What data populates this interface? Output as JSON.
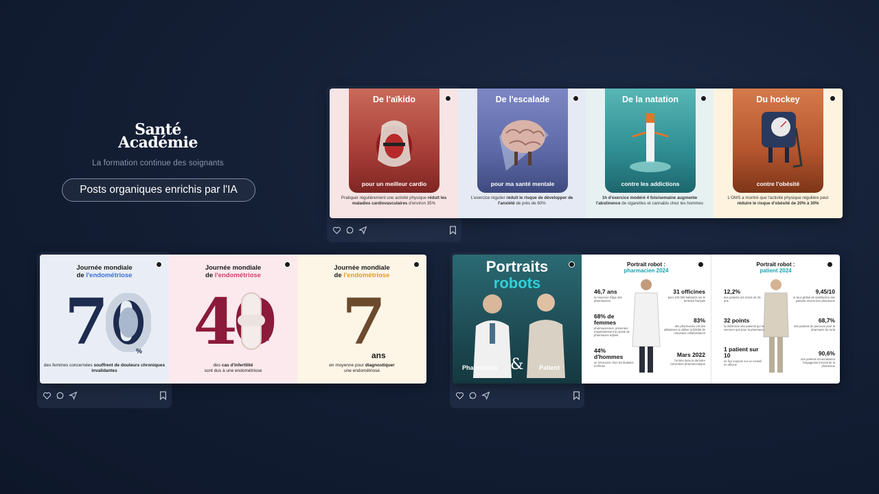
{
  "brand": {
    "logo_line1": "Santé",
    "logo_line2": "Académie",
    "tagline": "La formation continue des soignants",
    "pill_label": "Posts organiques enrichis par l'IA"
  },
  "sport_post": {
    "slides": [
      {
        "title": "De l'aïkido",
        "subtitle": "pour un meilleur cardio",
        "desc_plain": "Pratiquer régulièrement une activité physique",
        "desc_bold": "réduit les maladies cardiovasculaires",
        "desc_tail": "d'environ 35%",
        "bg": "#f7e4e4",
        "card": "#b8473f"
      },
      {
        "title": "De l'escalade",
        "subtitle": "pour ma santé mentale",
        "desc_plain": "L'exercice régulier",
        "desc_bold": "réduit le risque de développer de l'anxiété",
        "desc_tail": "de près de 60%",
        "bg": "#e6eaf4",
        "card": "#6f79b6"
      },
      {
        "title": "De la natation",
        "subtitle": "contre les addictions",
        "desc_plain": "1h d'exercice modéré 4 fois/semaine",
        "desc_bold": "augmente l'abstinence",
        "desc_tail": "de cigarettes et cannabis chez les hommes",
        "bg": "#e7f1f2",
        "card": "#3b9ea3"
      },
      {
        "title": "Du hockey",
        "subtitle": "contre l'obésité",
        "desc_plain": "L'OMS a montré que l'activité physique régulière peut",
        "desc_bold": "réduire le risque d'obésité",
        "desc_tail": "de 20% à 30%",
        "bg": "#fdf3df",
        "card": "#c46a3f"
      }
    ]
  },
  "endo_post": {
    "slides": [
      {
        "title_line1": "Journée mondiale",
        "title_line2_plain": "de ",
        "title_line2_accent": "l'endométriose",
        "accent": "#3a6ed6",
        "big_number": "70",
        "unit": "%",
        "desc_plain": "des femmes concernées",
        "desc_bold": "souffrent de douleurs chroniques invalidantes",
        "bg": "#e9eef6",
        "num_color": "#1d2b4f"
      },
      {
        "title_line1": "Journée mondiale",
        "title_line2_plain": "de ",
        "title_line2_accent": "l'endométriose",
        "accent": "#d1416e",
        "big_number": "40",
        "unit": "%",
        "desc_plain": "des",
        "desc_bold": "cas d'infertilité",
        "desc_tail": "sont dus à une endométriose",
        "bg": "#fbe9ee",
        "num_color": "#8c1a3a"
      },
      {
        "title_line1": "Journée mondiale",
        "title_line2_plain": "de ",
        "title_line2_accent": "l'endométriose",
        "accent": "#e39b1e",
        "big_number": "7",
        "unit": "ans",
        "desc_plain": "en moyenne pour",
        "desc_bold": "diagnostiquer",
        "desc_tail": "une endométriose",
        "bg": "#fdf5e6",
        "num_color": "#6b4a2e"
      }
    ]
  },
  "portrait_post": {
    "cover": {
      "title_line1": "Portraits",
      "title_line2": "robots",
      "left_label": "Pharmacien",
      "ampersand": "&",
      "right_label": "Patient"
    },
    "pharmacist": {
      "title_plain": "Portrait robot :",
      "title_accent": "pharmacien 2024",
      "stats_left": [
        {
          "value": "46,7 ans",
          "note": "la moyenne d'âge des pharmaciens"
        },
        {
          "value": "68% de femmes",
          "note": "pharmaciennes, présentes majoritairement au poste de pharmacien adjoint"
        },
        {
          "value": "44% d'hommes",
          "note": "se retrouvent chez les titulaires d'officine"
        }
      ],
      "stats_right": [
        {
          "value": "31 officines",
          "note": "pour 100 000 habitants sur le territoire français"
        },
        {
          "value": "83%",
          "note": "des pharmacies ont des utilisateurs à utiliser la fidélité de nouveaux collaborateurs"
        },
        {
          "value": "Mars 2022",
          "note": "l'entrée dans la dernière convention pharmaceutique"
        }
      ]
    },
    "patient": {
      "title_plain": "Portrait robot :",
      "title_accent": "patient 2024",
      "stats_left": [
        {
          "value": "12,2%",
          "note": "des patients ont moins de 25 ans"
        },
        {
          "value": "32 points",
          "note": "la distinction des patients qui ne viennent que pour la pharmacie"
        },
        {
          "value": "1 patient sur 10",
          "note": "se fixe toujours sur un conseil en officine"
        }
      ],
      "stats_right": [
        {
          "value": "9,45/10",
          "note": "le taux global de satisfaction des patients envers leur pharmacie"
        },
        {
          "value": "68,7%",
          "note": "des patients du parcours pour la pharmacie du rural"
        },
        {
          "value": "90,6%",
          "note": "des patients reconnaissent l'engagement social de la pharmacie"
        }
      ]
    }
  }
}
